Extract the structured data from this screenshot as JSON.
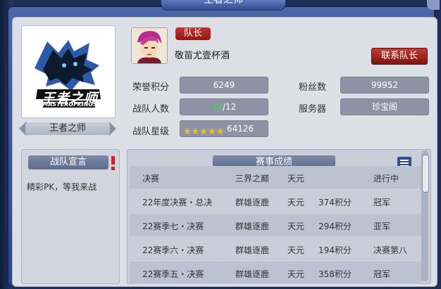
{
  "window": {
    "title": "王者之师"
  },
  "team": {
    "name": "王者之师",
    "logo_text_main": "王者之师",
    "logo_text_sub": "MASTEROFKINGS"
  },
  "captain": {
    "badge": "队长",
    "name": "敬苗尤壹杯酒",
    "contact_button": "联系队长"
  },
  "stats": {
    "honor_label": "荣誉积分",
    "honor_value": "6249",
    "fans_label": "粉丝数",
    "fans_value": "99952",
    "members_label": "战队人数",
    "members_current": "12",
    "members_max": "/12",
    "server_label": "服务器",
    "server_value": "珍宝阁",
    "stars_label": "战队星级",
    "stars_count": 5,
    "stars_value": "64126"
  },
  "declaration": {
    "title": "战队宣言",
    "text": "精彩PK，等我来战"
  },
  "results": {
    "title": "赛事成绩",
    "rows": [
      {
        "event": "决赛",
        "stage": "三界之巅",
        "server": "天元",
        "points": "",
        "result": "进行中"
      },
      {
        "event": "22年度决赛・总决",
        "stage": "群雄逐鹿",
        "server": "天元",
        "points": "374积分",
        "result": "冠军"
      },
      {
        "event": "22赛季七・决赛",
        "stage": "群雄逐鹿",
        "server": "天元",
        "points": "294积分",
        "result": "亚军"
      },
      {
        "event": "22赛季六・决赛",
        "stage": "群雄逐鹿",
        "server": "天元",
        "points": "194积分",
        "result": "决赛第八"
      },
      {
        "event": "22赛季五・决赛",
        "stage": "群雄逐鹿",
        "server": "天元",
        "points": "358积分",
        "result": "冠军"
      }
    ]
  },
  "colors": {
    "accent_red": "#b3231e",
    "member_green": "#39e635",
    "star_gold": "#f4c21b"
  }
}
